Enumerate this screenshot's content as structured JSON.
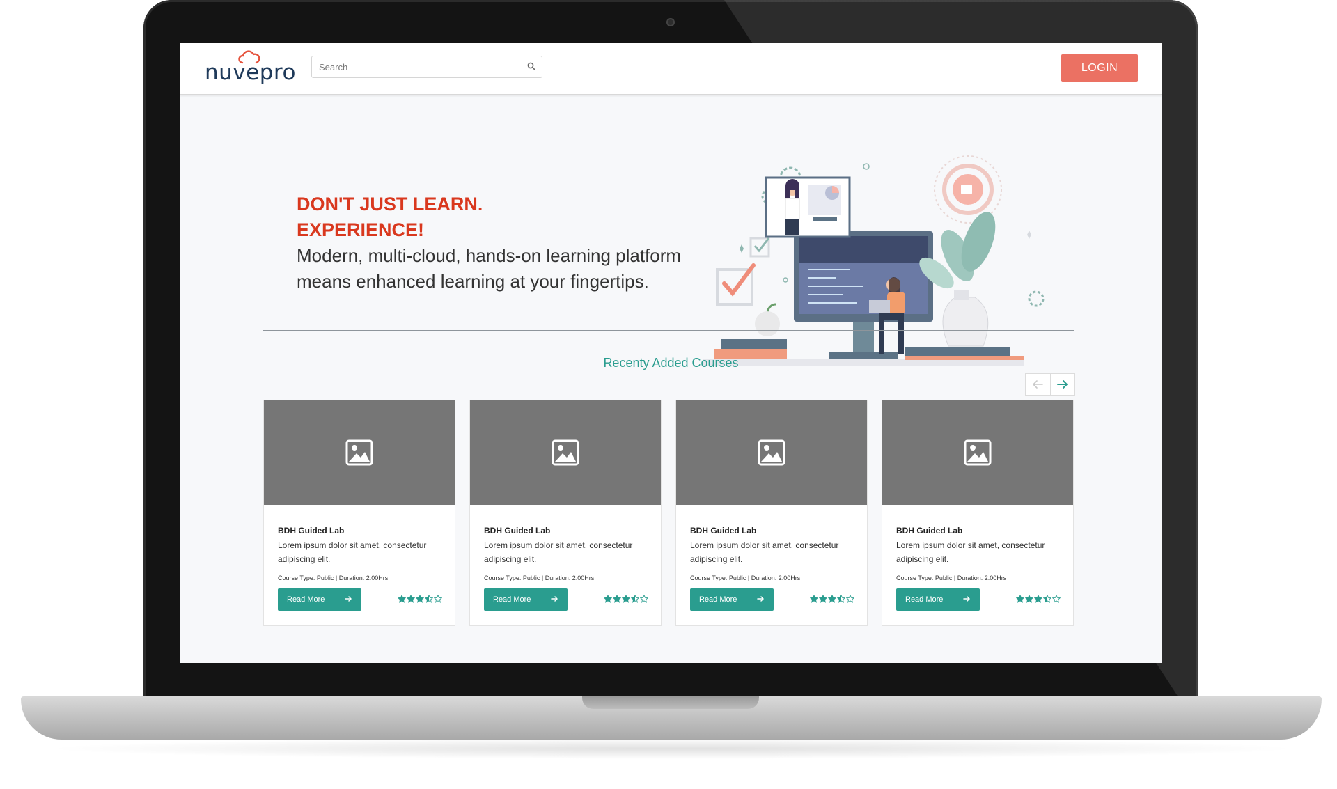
{
  "header": {
    "logo_text": "nuvepro",
    "search_placeholder": "Search",
    "login_label": "LOGIN"
  },
  "hero": {
    "headline_line1": "DON'T JUST LEARN.",
    "headline_line2": "EXPERIENCE!",
    "subline1": "Modern, multi-cloud, hands-on learning platform",
    "subline2": "means enhanced learning at your fingertips."
  },
  "courses": {
    "section_title": "Recenty Added Courses",
    "items": [
      {
        "title": "BDH Guided Lab",
        "description": "Lorem ipsum dolor sit amet, consectetur adipiscing elit.",
        "course_type": "Course Type: Public",
        "duration": "Duration: 2:00Hrs",
        "button_label": "Read More",
        "rating": 3.5
      },
      {
        "title": "BDH Guided Lab",
        "description": "Lorem ipsum dolor sit amet, consectetur adipiscing elit.",
        "course_type": "Course Type: Public",
        "duration": "Duration: 2:00Hrs",
        "button_label": "Read More",
        "rating": 3.5
      },
      {
        "title": "BDH Guided Lab",
        "description": "Lorem ipsum dolor sit amet, consectetur adipiscing elit.",
        "course_type": "Course Type: Public",
        "duration": "Duration: 2:00Hrs",
        "button_label": "Read More",
        "rating": 3.5
      },
      {
        "title": "BDH Guided Lab",
        "description": "Lorem ipsum dolor sit amet, consectetur adipiscing elit.",
        "course_type": "Course Type: Public",
        "duration": "Duration: 2:00Hrs",
        "button_label": "Read More",
        "rating": 3.5
      }
    ]
  },
  "colors": {
    "accent": "#2a9d8f",
    "login": "#eb7163",
    "headline": "#d9381e",
    "placeholder": "#767676"
  },
  "icons": {
    "search": "search-icon",
    "image": "image-placeholder-icon",
    "arrow_left": "arrow-left-icon",
    "arrow_right": "arrow-right-icon",
    "star": "star-icon"
  }
}
